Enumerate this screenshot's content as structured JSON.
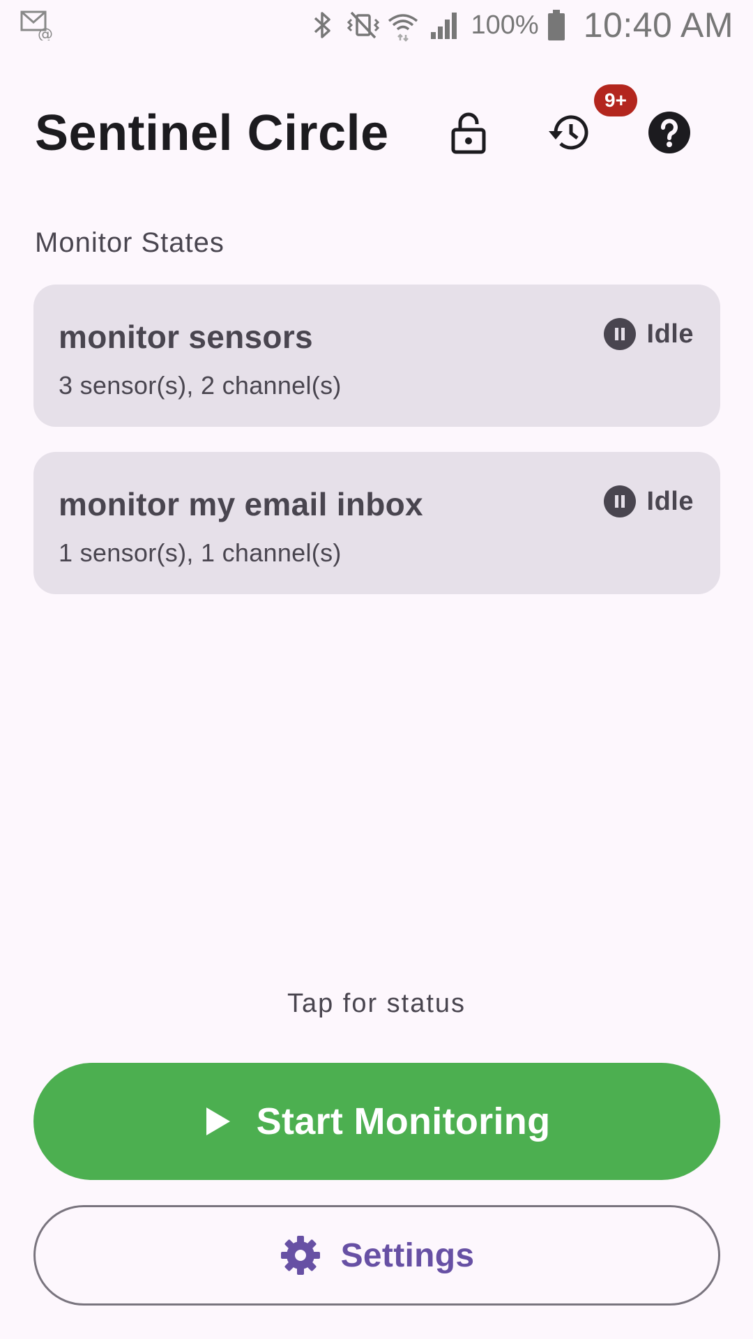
{
  "status_bar": {
    "battery_percent": "100%",
    "time": "10:40 AM",
    "icons": [
      "email-notification-icon",
      "bluetooth-icon",
      "vibrate-off-icon",
      "wifi-icon",
      "cellular-signal-icon",
      "battery-icon"
    ]
  },
  "header": {
    "title": "Sentinel Circle",
    "history_badge": "9+",
    "icons": [
      "lock-open-icon",
      "history-icon",
      "help-icon"
    ]
  },
  "section": {
    "title": "Monitor States"
  },
  "monitors": [
    {
      "name": "monitor sensors",
      "summary": "3 sensor(s), 2 channel(s)",
      "status": "Idle",
      "status_icon": "pause-icon"
    },
    {
      "name": "monitor my email inbox",
      "summary": "1 sensor(s), 1 channel(s)",
      "status": "Idle",
      "status_icon": "pause-icon"
    }
  ],
  "footer": {
    "hint": "Tap for status",
    "start_label": "Start Monitoring",
    "start_icon": "play-icon",
    "settings_label": "Settings",
    "settings_icon": "gear-icon"
  },
  "colors": {
    "background": "#fdf7fd",
    "card": "#e6e0e9",
    "start_button": "#4caf50",
    "accent": "#6750a4",
    "badge": "#b3261e"
  }
}
